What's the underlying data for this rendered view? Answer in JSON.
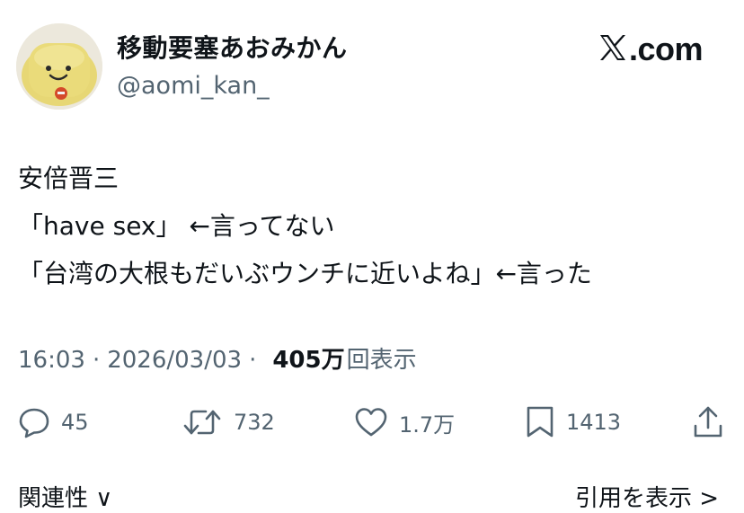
{
  "user": {
    "display_name": "移動要塞あおみかん",
    "handle": "@aomi_kan_"
  },
  "brand": {
    "label": ".com",
    "icon": "x-logo-icon"
  },
  "tweet": {
    "lines": [
      "安倍晋三",
      "「have sex」 ←言ってない",
      "「台湾の大根もだいぶウンチに近いよね」←言った"
    ]
  },
  "meta": {
    "time": "16:03",
    "separator": "·",
    "date": "2026/03/03",
    "views": "405万",
    "views_label": "回表示"
  },
  "actions": {
    "reply": {
      "icon": "reply-icon",
      "count": "45"
    },
    "repost": {
      "icon": "repost-icon",
      "count": "732"
    },
    "like": {
      "icon": "heart-icon",
      "count": "1.7万"
    },
    "bookmark": {
      "icon": "bookmark-icon",
      "count": "1413"
    },
    "share": {
      "icon": "share-icon"
    }
  },
  "footer": {
    "left": "関連性 ∨",
    "right": "引用を表示 >"
  },
  "colors": {
    "text": "#0f1419",
    "secondary": "#536471",
    "background": "#ffffff"
  }
}
